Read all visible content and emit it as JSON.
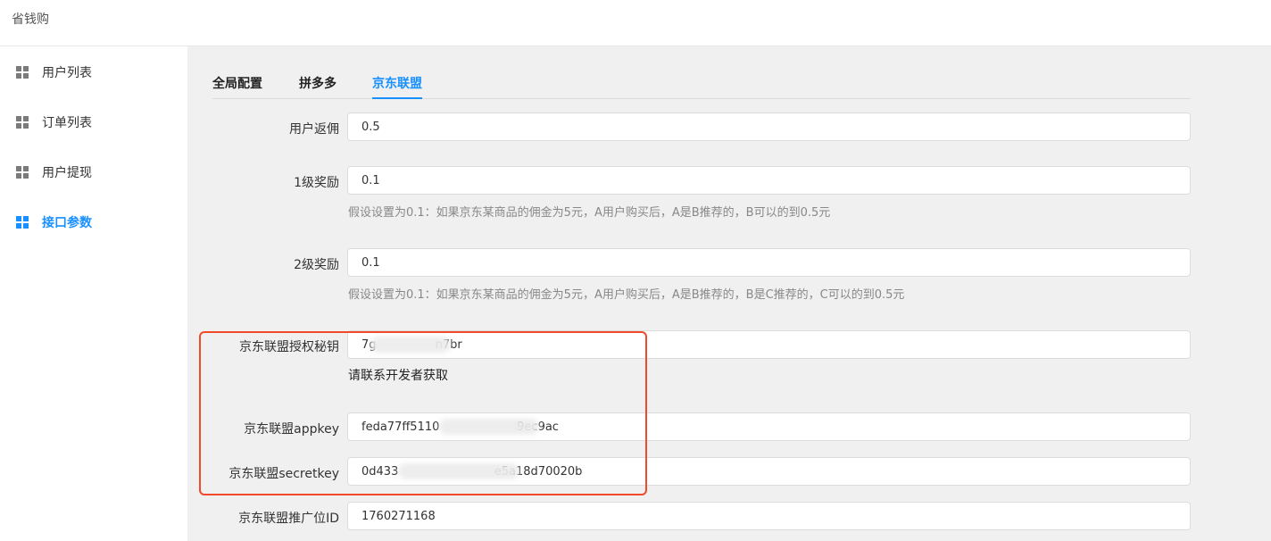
{
  "app": {
    "title": "省钱购"
  },
  "sidebar": {
    "items": [
      {
        "label": "用户列表",
        "icon": "grid-icon",
        "active": false
      },
      {
        "label": "订单列表",
        "icon": "grid-icon",
        "active": false
      },
      {
        "label": "用户提现",
        "icon": "grid-icon",
        "active": false
      },
      {
        "label": "接口参数",
        "icon": "grid-icon",
        "active": true
      }
    ]
  },
  "tabs": [
    {
      "label": "全局配置",
      "active": false
    },
    {
      "label": "拼多多",
      "active": false
    },
    {
      "label": "京东联盟",
      "active": true
    }
  ],
  "form": {
    "user_rebate": {
      "label": "用户返佣",
      "value": "0.5"
    },
    "level1": {
      "label": "1级奖励",
      "value": "0.1",
      "hint": "假设设置为0.1：如果京东某商品的佣金为5元，A用户购买后，A是B推荐的，B可以的到0.5元"
    },
    "level2": {
      "label": "2级奖励",
      "value": "0.1",
      "hint": "假设设置为0.1：如果京东某商品的佣金为5元，A用户购买后，A是B推荐的，B是C推荐的，C可以的到0.5元"
    },
    "auth_key": {
      "label": "京东联盟授权秘钥",
      "value": "7g                n7br",
      "hint": "请联系开发者获取"
    },
    "appkey": {
      "label": "京东联盟appkey",
      "value": "feda77ff5110                     9ec9ac"
    },
    "secretkey": {
      "label": "京东联盟secretkey",
      "value": "0d433                          e5a18d70020b"
    },
    "position_id": {
      "label": "京东联盟推广位ID",
      "value": "1760271168"
    }
  },
  "colors": {
    "accent": "#1890ff",
    "highlight": "#f04a2a"
  }
}
